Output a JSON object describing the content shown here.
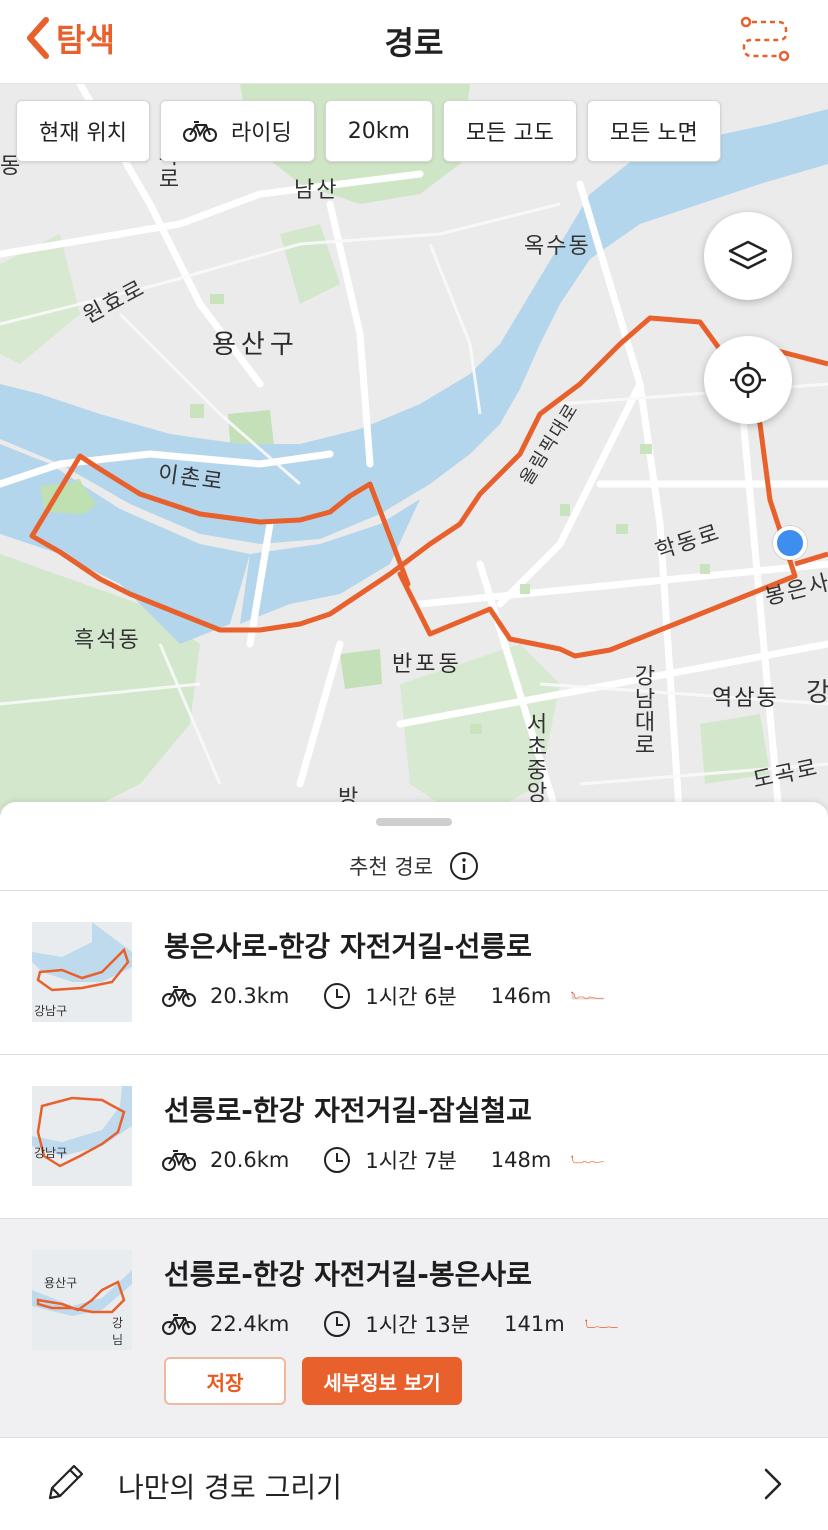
{
  "header": {
    "back_label": "탐색",
    "title": "경로",
    "accent_color": "#e8602c",
    "right_icon": "route-create-icon"
  },
  "filters": [
    {
      "label": "현재 위치"
    },
    {
      "label": "라이딩",
      "icon": "bike-icon"
    },
    {
      "label": "20km"
    },
    {
      "label": "모든 고도"
    },
    {
      "label": "모든 노면"
    }
  ],
  "map": {
    "labels": {
      "namsan": "남산",
      "oksu": "옥수동",
      "wonhyo": "원효로",
      "yongsan": "용산구",
      "ichon": "이촌로",
      "heukseok": "흑석동",
      "banpo": "반포동",
      "hakdong": "학동로",
      "yeoksam": "역삼동",
      "dogok": "도곡로",
      "gangnamdaero": "강남대로",
      "seochojungang": "서초중앙",
      "bongeun": "봉은사",
      "olympic": "올림픽대로",
      "paro": "파로",
      "edge_dong": "동",
      "edge_bang": "방",
      "edge_gang": "강"
    },
    "user_location_color": "#3e8ef0",
    "route_color": "#e8602c"
  },
  "sheet": {
    "title": "추천 경로"
  },
  "routes": [
    {
      "name": "봉은사로-한강 자전거길-선릉로",
      "distance": "20.3km",
      "time": "1시간 6분",
      "elevation": "146m",
      "thumb_label": "강남구",
      "selected": false
    },
    {
      "name": "선릉로-한강 자전거길-잠실철교",
      "distance": "20.6km",
      "time": "1시간 7분",
      "elevation": "148m",
      "thumb_label": "강남구",
      "selected": false
    },
    {
      "name": "선릉로-한강 자전거길-봉은사로",
      "distance": "22.4km",
      "time": "1시간 13분",
      "elevation": "141m",
      "thumb_label": "용산구",
      "thumb_label2": "강님",
      "selected": true,
      "save_label": "저장",
      "detail_label": "세부정보 보기"
    }
  ],
  "draw": {
    "label": "나만의 경로 그리기"
  }
}
